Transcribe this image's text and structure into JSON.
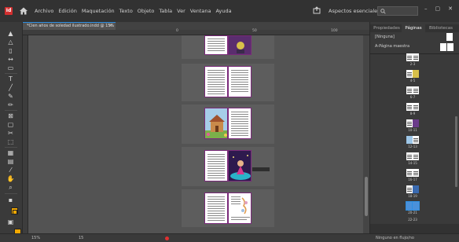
{
  "app": {
    "logo": "Id",
    "menu": [
      "Archivo",
      "Edición",
      "Maquetación",
      "Texto",
      "Objeto",
      "Tabla",
      "Ver",
      "Ventana",
      "Ayuda"
    ],
    "workspace": "Aspectos esenciales ⌄",
    "window_controls": [
      "–",
      "▢",
      "✕"
    ]
  },
  "document": {
    "tab_title": "*Cien años de soledad ilustrado.indd @ 15%",
    "tab_close": "×",
    "ruler_ticks": [
      "0",
      "50",
      "100"
    ]
  },
  "icons": {
    "home": "home-icon",
    "share": "share-icon",
    "search": "search-icon"
  },
  "colors": {
    "accent": "#2e8ee0",
    "fill_swatch": "#f2a800",
    "page_border": "#7a2a7a",
    "preflight_error": "#e03030"
  },
  "panel": {
    "tabs": [
      "Propiedades",
      "Páginas",
      "Bibliotecas"
    ],
    "active_tab": "Páginas",
    "master_none": "[Ninguna]",
    "master_a": "A-Página maestra",
    "page_numbers": [
      "2-3",
      "4-5",
      "6-7",
      "8-9",
      "10-11",
      "12-13",
      "14-15",
      "16-17",
      "18-19",
      "20-21",
      "22-23"
    ]
  },
  "status": {
    "zoom": "15%",
    "page": "15",
    "right": "Ninguno en flujo/no"
  }
}
